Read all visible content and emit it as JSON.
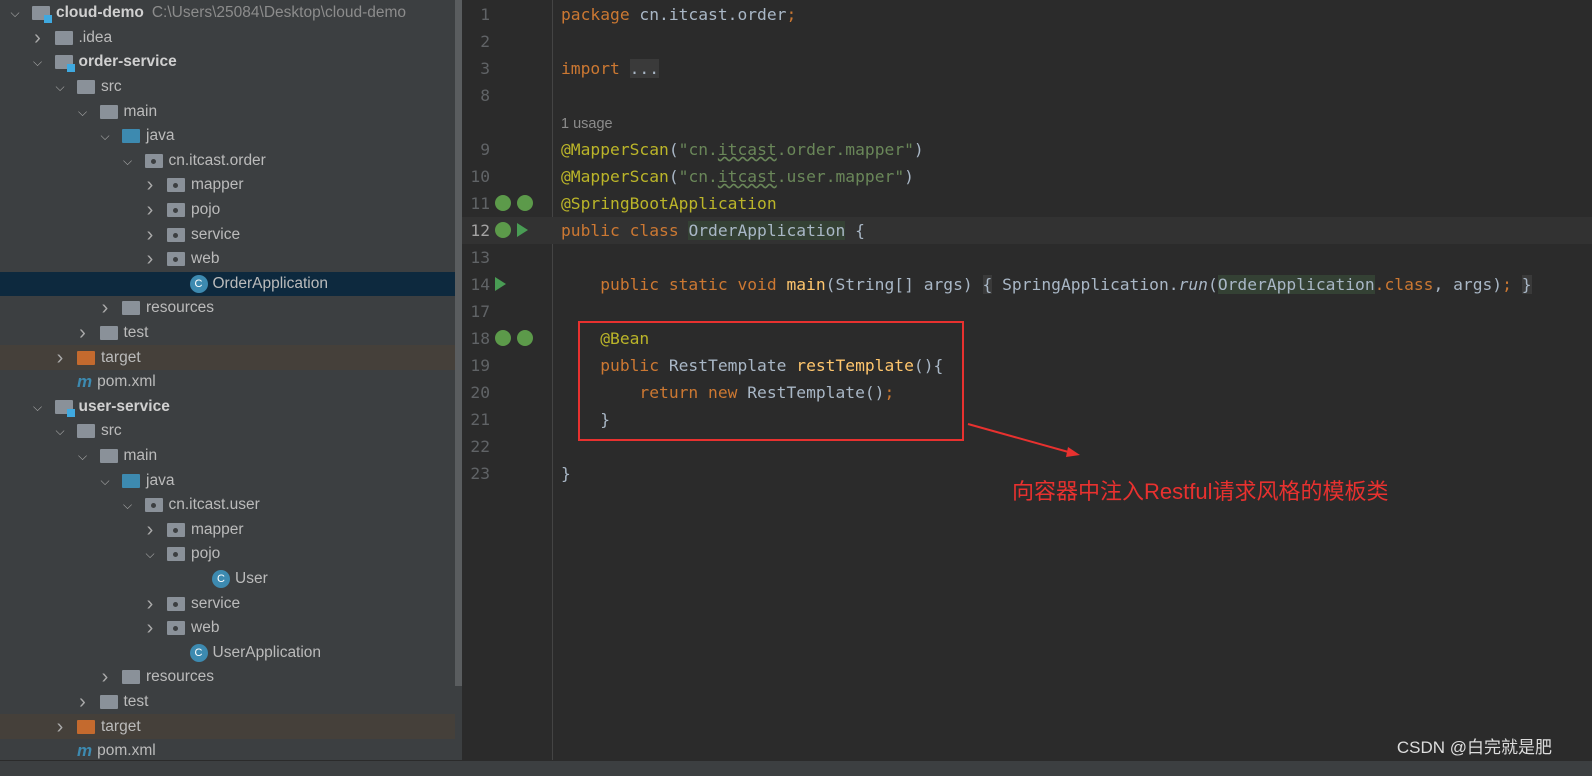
{
  "tree": [
    {
      "label": "cloud-demo",
      "path": "C:\\Users\\25084\\Desktop\\cloud-demo",
      "depth": 0,
      "chev": "down",
      "icon": "module",
      "bold": true
    },
    {
      "label": ".idea",
      "depth": 1,
      "chev": "right",
      "icon": "folder"
    },
    {
      "label": "order-service",
      "depth": 1,
      "chev": "down",
      "icon": "module",
      "bold": true
    },
    {
      "label": "src",
      "depth": 2,
      "chev": "down",
      "icon": "folder"
    },
    {
      "label": "main",
      "depth": 3,
      "chev": "down",
      "icon": "folder"
    },
    {
      "label": "java",
      "depth": 4,
      "chev": "down",
      "icon": "source"
    },
    {
      "label": "cn.itcast.order",
      "depth": 5,
      "chev": "down",
      "icon": "package"
    },
    {
      "label": "mapper",
      "depth": 6,
      "chev": "right",
      "icon": "package"
    },
    {
      "label": "pojo",
      "depth": 6,
      "chev": "right",
      "icon": "package"
    },
    {
      "label": "service",
      "depth": 6,
      "chev": "right",
      "icon": "package"
    },
    {
      "label": "web",
      "depth": 6,
      "chev": "right",
      "icon": "package"
    },
    {
      "label": "OrderApplication",
      "depth": 7,
      "icon": "class",
      "selected": true
    },
    {
      "label": "resources",
      "depth": 4,
      "chev": "right",
      "icon": "folder"
    },
    {
      "label": "test",
      "depth": 3,
      "chev": "right",
      "icon": "folder"
    },
    {
      "label": "target",
      "depth": 2,
      "chev": "right",
      "icon": "excluded",
      "excluded": true
    },
    {
      "label": "pom.xml",
      "depth": 2,
      "icon": "maven"
    },
    {
      "label": "user-service",
      "depth": 1,
      "chev": "down",
      "icon": "module",
      "bold": true
    },
    {
      "label": "src",
      "depth": 2,
      "chev": "down",
      "icon": "folder"
    },
    {
      "label": "main",
      "depth": 3,
      "chev": "down",
      "icon": "folder"
    },
    {
      "label": "java",
      "depth": 4,
      "chev": "down",
      "icon": "source"
    },
    {
      "label": "cn.itcast.user",
      "depth": 5,
      "chev": "down",
      "icon": "package"
    },
    {
      "label": "mapper",
      "depth": 6,
      "chev": "right",
      "icon": "package"
    },
    {
      "label": "pojo",
      "depth": 6,
      "chev": "down",
      "icon": "package"
    },
    {
      "label": "User",
      "depth": 8,
      "icon": "class"
    },
    {
      "label": "service",
      "depth": 6,
      "chev": "right",
      "icon": "package"
    },
    {
      "label": "web",
      "depth": 6,
      "chev": "right",
      "icon": "package"
    },
    {
      "label": "UserApplication",
      "depth": 7,
      "icon": "class"
    },
    {
      "label": "resources",
      "depth": 4,
      "chev": "right",
      "icon": "folder"
    },
    {
      "label": "test",
      "depth": 3,
      "chev": "right",
      "icon": "folder"
    },
    {
      "label": "target",
      "depth": 2,
      "chev": "right",
      "icon": "excluded",
      "excluded": true
    },
    {
      "label": "pom.xml",
      "depth": 2,
      "icon": "maven"
    }
  ],
  "editor": {
    "lines": [
      {
        "n": "1",
        "t": [
          [
            "k",
            "package "
          ],
          [
            "",
            "cn.itcast.order"
          ],
          [
            "k",
            ";"
          ]
        ]
      },
      {
        "n": "2",
        "t": []
      },
      {
        "n": "3",
        "t": [
          [
            "k",
            "import "
          ],
          [
            "fo",
            "..."
          ]
        ]
      },
      {
        "n": "8",
        "t": []
      },
      {
        "n": "",
        "usage": "1 usage",
        "t": []
      },
      {
        "n": "9",
        "t": [
          [
            "a",
            "@MapperScan"
          ],
          [
            "",
            "("
          ],
          [
            "s",
            "\"cn."
          ],
          [
            "s u",
            "itcast"
          ],
          [
            "s",
            ".order.mapper\""
          ],
          [
            "",
            ")"
          ]
        ]
      },
      {
        "n": "10",
        "t": [
          [
            "a",
            "@MapperScan"
          ],
          [
            "",
            "("
          ],
          [
            "s",
            "\"cn."
          ],
          [
            "s u",
            "itcast"
          ],
          [
            "s",
            ".user.mapper\""
          ],
          [
            "",
            ")"
          ]
        ]
      },
      {
        "n": "11",
        "g": [
          "bean-search",
          "bean-check"
        ],
        "t": [
          [
            "a",
            "@SpringBootApplication"
          ]
        ]
      },
      {
        "n": "12",
        "cur": true,
        "g": [
          "bean-class",
          "run"
        ],
        "t": [
          [
            "k",
            "public class "
          ],
          [
            "hl",
            "OrderApplication"
          ],
          [
            "",
            " {"
          ]
        ]
      },
      {
        "n": "13",
        "t": []
      },
      {
        "n": "14",
        "g": [
          "run"
        ],
        "t": [
          [
            "k",
            "    public static void "
          ],
          [
            "f",
            "main"
          ],
          [
            "",
            "(String[] args) "
          ],
          [
            "fo",
            "{"
          ],
          [
            "",
            " SpringApplication."
          ],
          [
            "i",
            "run"
          ],
          [
            "",
            "("
          ],
          [
            "hl",
            "OrderApplication"
          ],
          [
            "k",
            ".class"
          ],
          [
            "",
            ", args)"
          ],
          [
            "k",
            ";"
          ],
          [
            "",
            " "
          ],
          [
            "fo",
            "}"
          ]
        ]
      },
      {
        "n": "17",
        "t": []
      },
      {
        "n": "18",
        "g": [
          "bean-nav",
          "bean-check"
        ],
        "t": [
          [
            "a",
            "    @Bean"
          ]
        ]
      },
      {
        "n": "19",
        "t": [
          [
            "k",
            "    public "
          ],
          [
            "",
            "RestTemplate "
          ],
          [
            "f",
            "restTemplate"
          ],
          [
            "",
            "(){"
          ]
        ]
      },
      {
        "n": "20",
        "t": [
          [
            "k",
            "        return new "
          ],
          [
            "",
            "RestTemplate()"
          ],
          [
            "k",
            ";"
          ]
        ]
      },
      {
        "n": "21",
        "t": [
          [
            "",
            "    }"
          ]
        ]
      },
      {
        "n": "22",
        "t": []
      },
      {
        "n": "23",
        "t": [
          [
            "",
            "}"
          ]
        ]
      }
    ]
  },
  "annotation": {
    "text": "向容器中注入Restful请求风格的模板类",
    "color": "#e8312f"
  },
  "watermark": "CSDN @白完就是肥"
}
